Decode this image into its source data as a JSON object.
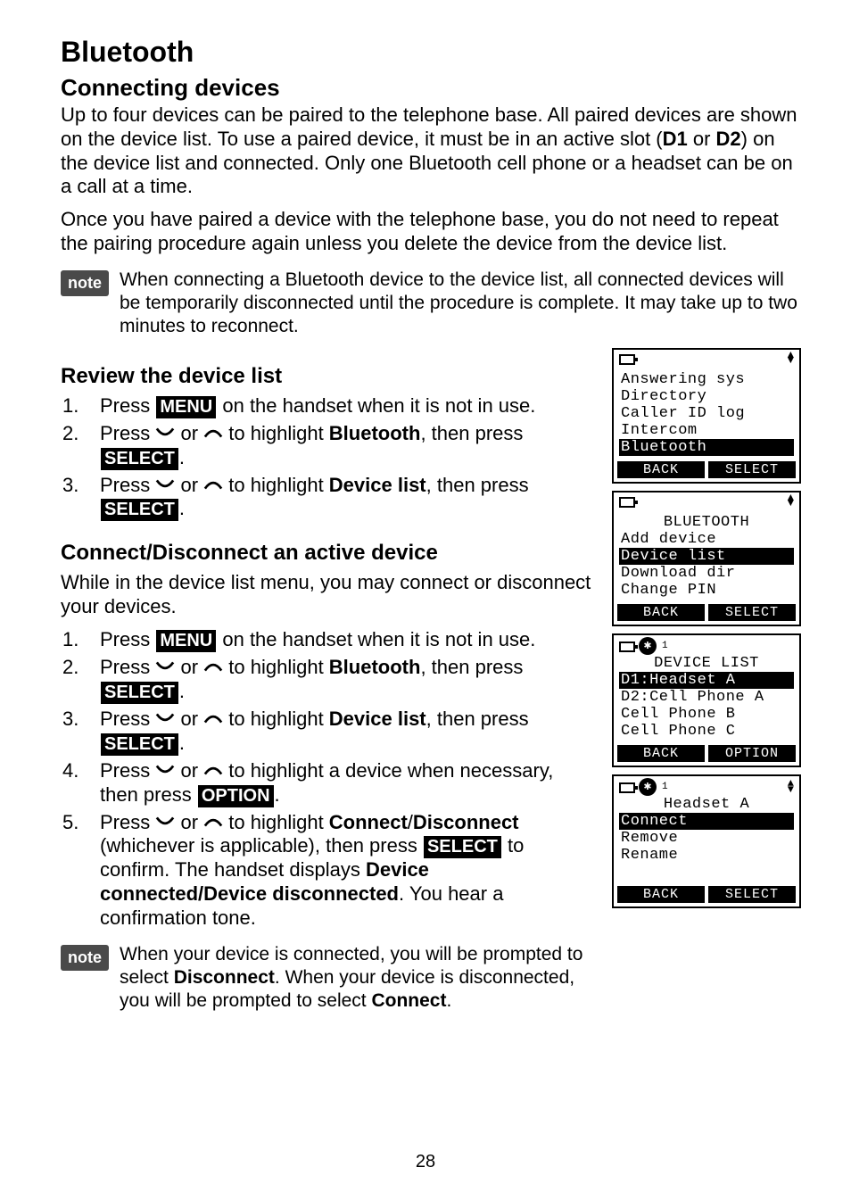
{
  "page_number": "28",
  "title": "Bluetooth",
  "subtitle": "Connecting devices",
  "intro_p1_a": "Up to four devices can be paired to the telephone base. All paired devices are shown on the device list. To use a paired device, it must be in an active slot (",
  "intro_p1_d1": "D1",
  "intro_p1_or": " or ",
  "intro_p1_d2": "D2",
  "intro_p1_b": ") on the device list and connected. Only one Bluetooth cell phone or a headset can be on a call at a time.",
  "intro_p2": "Once you have paired a device with the telephone base, you do not need to repeat the pairing procedure again unless you delete the device from the device list.",
  "note1_badge": "note",
  "note1_text": "When connecting a Bluetooth device to the device list, all connected devices will be temporarily disconnected until the procedure is complete. It may take up to two minutes to reconnect.",
  "review_heading": "Review the device list",
  "review_steps": {
    "s1_a": "Press ",
    "s1_menu": "MENU",
    "s1_b": " on the handset when it is not in use.",
    "s2_a": "Press ",
    "s2_b": " or ",
    "s2_c": " to highlight ",
    "s2_bt": "Bluetooth",
    "s2_d": ", then press ",
    "s2_select": "SELECT",
    "s2_e": ".",
    "s3_a": "Press ",
    "s3_b": " or ",
    "s3_c": " to highlight ",
    "s3_dl": "Device list",
    "s3_d": ", then press ",
    "s3_select": "SELECT",
    "s3_e": "."
  },
  "connect_heading": "Connect/Disconnect an active device",
  "connect_intro": "While in the device list menu, you may connect or disconnect your devices.",
  "connect_steps": {
    "s1_a": "Press ",
    "s1_menu": "MENU",
    "s1_b": " on the handset when it is not in use.",
    "s2_a": "Press ",
    "s2_b": " or ",
    "s2_c": " to highlight ",
    "s2_bt": "Bluetooth",
    "s2_d": ", then press ",
    "s2_select": "SELECT",
    "s2_e": ".",
    "s3_a": "Press ",
    "s3_b": " or ",
    "s3_c": " to highlight ",
    "s3_dl": "Device list",
    "s3_d": ", then press ",
    "s3_select": "SELECT",
    "s3_e": ".",
    "s4_a": "Press ",
    "s4_b": " or ",
    "s4_c": " to highlight a device when necessary, then press ",
    "s4_option": "OPTION",
    "s4_d": ".",
    "s5_a": "Press ",
    "s5_b": " or ",
    "s5_c": " to highlight ",
    "s5_conn": "Connect",
    "s5_slash": "/",
    "s5_disc": "Disconnect",
    "s5_d": " (whichever is applicable), then press ",
    "s5_select": "SELECT",
    "s5_e": " to confirm. The handset displays ",
    "s5_msg": "Device connected/Device disconnected",
    "s5_f": ". You hear a confirmation tone."
  },
  "note2_badge": "note",
  "note2_a": "When your device is connected, you will be prompted to select ",
  "note2_disc": "Disconnect",
  "note2_b": ". When your device is disconnected, you will be prompted to select ",
  "note2_conn": "Connect",
  "note2_c": ".",
  "lcd1": {
    "l1": "Answering sys",
    "l2": "Directory",
    "l3": "Caller ID log",
    "l4": "Intercom",
    "l5": "Bluetooth",
    "sk_left": "BACK",
    "sk_right": "SELECT"
  },
  "lcd2": {
    "title": "BLUETOOTH",
    "l1": "Add device",
    "l2": "Device list",
    "l3": "Download dir",
    "l4": "Change PIN",
    "sk_left": "BACK",
    "sk_right": "SELECT"
  },
  "lcd3": {
    "sub": "1",
    "title": "DEVICE LIST",
    "l1": "D1:Headset A",
    "l2": "D2:Cell Phone A",
    "l3": "Cell Phone B",
    "l4": "Cell Phone C",
    "sk_left": "BACK",
    "sk_right": "OPTION"
  },
  "lcd4": {
    "sub": "1",
    "title": "Headset A",
    "l1": "Connect",
    "l2": "Remove",
    "l3": "Rename",
    "sk_left": "BACK",
    "sk_right": "SELECT"
  }
}
